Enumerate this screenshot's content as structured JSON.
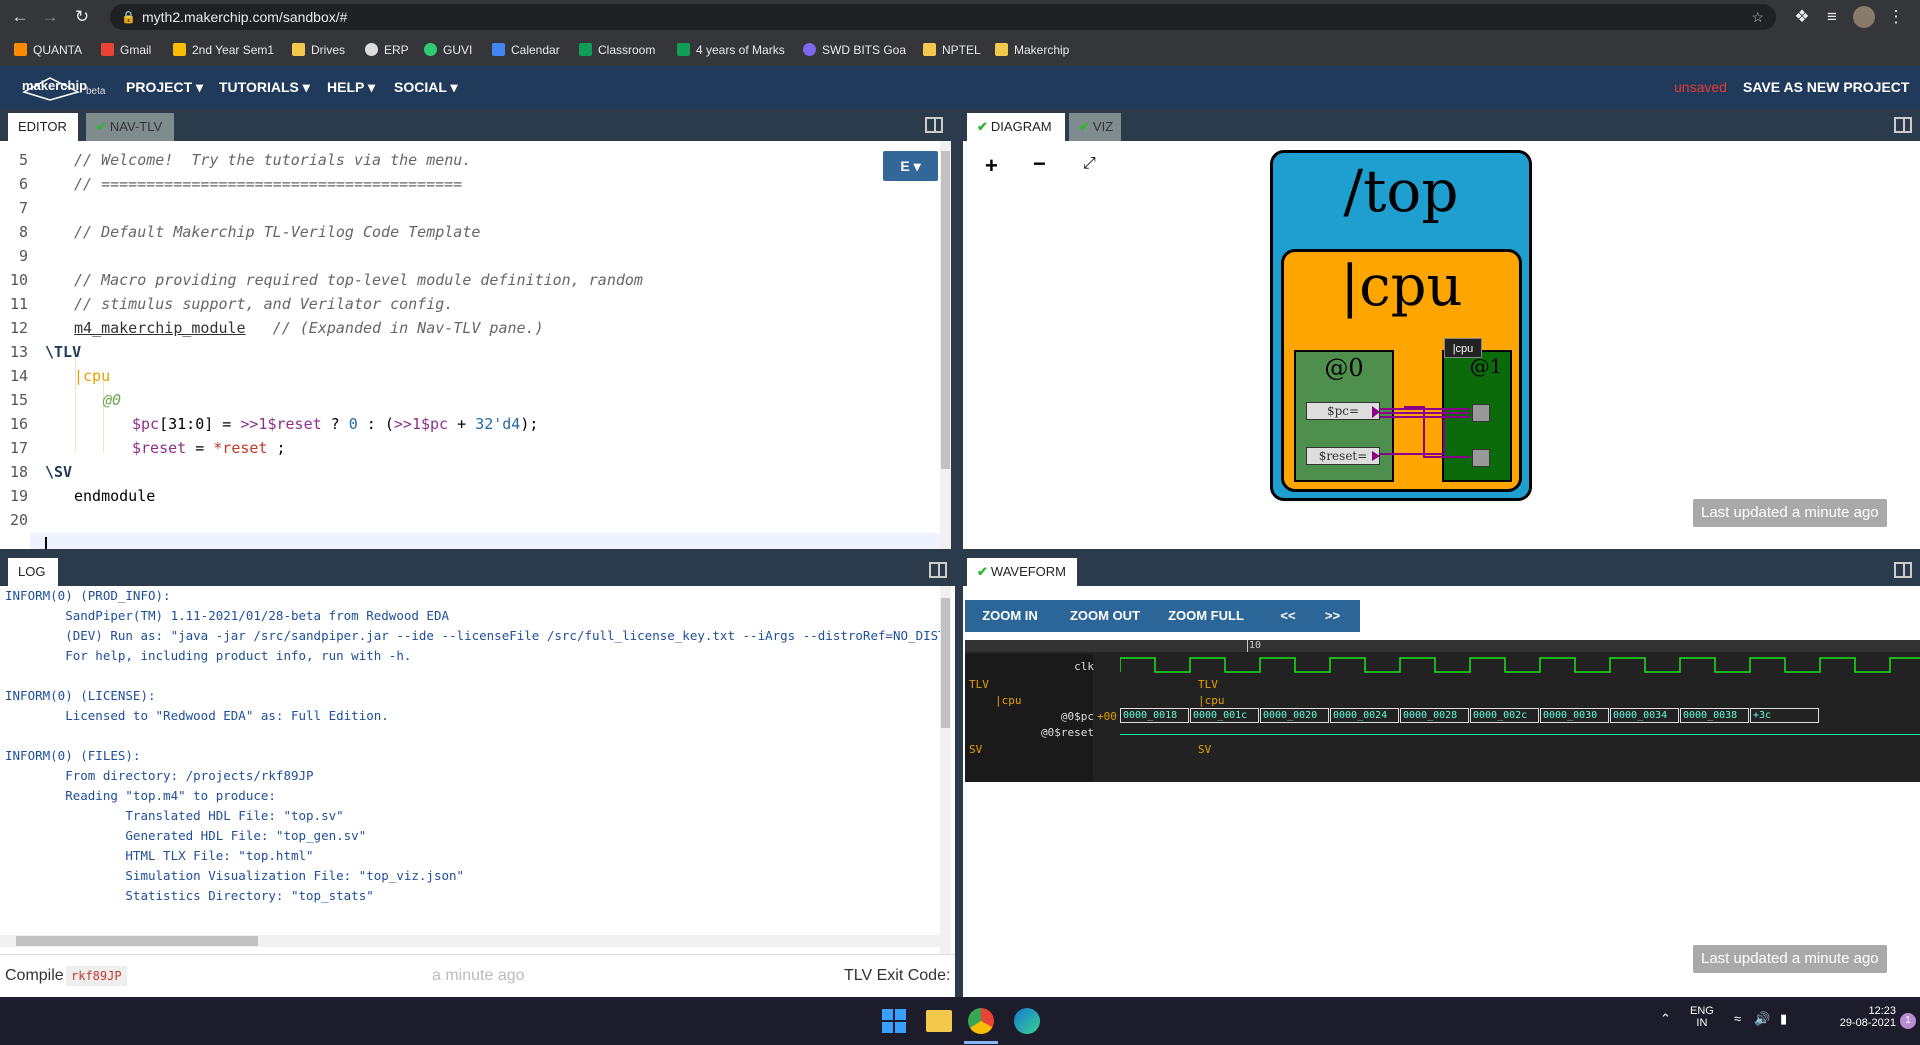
{
  "browser": {
    "url": "myth2.makerchip.com/sandbox/#",
    "bookmarks": [
      "QUANTA",
      "Gmail",
      "2nd Year Sem1",
      "Drives",
      "ERP",
      "GUVI",
      "Calendar",
      "Classroom",
      "4 years of Marks",
      "SWD BITS Goa",
      "NPTEL",
      "Makerchip"
    ]
  },
  "app": {
    "logo": "makerchip",
    "logo_sub": "beta",
    "menu": [
      "PROJECT",
      "TUTORIALS",
      "HELP",
      "SOCIAL"
    ],
    "unsaved": "unsaved",
    "save_button": "SAVE AS NEW PROJECT"
  },
  "editor": {
    "tabs": [
      "EDITOR",
      "NAV-TLV"
    ],
    "mode_button": "E",
    "line_numbers": [
      "5",
      "6",
      "7",
      "8",
      "9",
      "10",
      "11",
      "12",
      "13",
      "14",
      "15",
      "16",
      "17",
      "18",
      "19",
      "20"
    ],
    "lines": {
      "l5": "// Welcome!  Try the tutorials via the menu.",
      "l6": "// ========================================",
      "l8": "// Default Makerchip TL-Verilog Code Template",
      "l10": "// Macro providing required top-level module definition, random",
      "l11": "// stimulus support, and Verilator config.",
      "l12a": "m4_makerchip_module",
      "l12b": "   // (Expanded in Nav-TLV pane.)",
      "l13": "\\TLV",
      "l14": "|cpu",
      "l15": "@0",
      "l16a": "$pc",
      "l16b": "[31:0] = ",
      "l16c": ">>1$reset",
      "l16d": " ? ",
      "l16e": "0",
      "l16f": " : (",
      "l16g": ">>1$pc",
      "l16h": " + ",
      "l16i": "32'd4",
      "l16j": ");",
      "l17a": "$reset",
      "l17b": " = ",
      "l17c": "*reset",
      "l17d": " ;",
      "l18": "\\SV",
      "l19": "endmodule"
    }
  },
  "diagram": {
    "tabs": [
      "DIAGRAM",
      "VIZ"
    ],
    "top_label": "/top",
    "cpu_label": "|cpu",
    "stage_label": "@0",
    "stage2_label": "@1",
    "tooltip": "|cpu",
    "pc_label": "$pc=",
    "reset_label": "$reset=",
    "updated": "Last updated a minute ago"
  },
  "log": {
    "tab": "LOG",
    "lines": [
      "INFORM(0) (PROD_INFO):",
      "        SandPiper(TM) 1.11-2021/01/28-beta from Redwood EDA",
      "        (DEV) Run as: \"java -jar /src/sandpiper.jar --ide --licenseFile /src/full_license_key.txt --iArgs --distroRef=NO_DIST",
      "        For help, including product info, run with -h.",
      "",
      "INFORM(0) (LICENSE):",
      "        Licensed to \"Redwood EDA\" as: Full Edition.",
      "",
      "INFORM(0) (FILES):",
      "        From directory: /projects/rkf89JP",
      "        Reading \"top.m4\" to produce:",
      "                Translated HDL File: \"top.sv\"",
      "                Generated HDL File: \"top_gen.sv\"",
      "                HTML TLX File: \"top.html\"",
      "                Simulation Visualization File: \"top_viz.json\"",
      "                Statistics Directory: \"top_stats\""
    ],
    "compile_label": "Compile",
    "compile_id": "rkf89JP",
    "compile_time": "a minute ago",
    "exit_label": "TLV Exit Code:"
  },
  "waveform": {
    "tab": "WAVEFORM",
    "buttons": [
      "ZOOM IN",
      "ZOOM OUT",
      "ZOOM FULL",
      "<<",
      ">>"
    ],
    "cycle_marker": "10",
    "signals": {
      "clk": "clk",
      "tlv": "TLV",
      "cpu": "|cpu",
      "pc": "@0$pc",
      "pc_val": "+00",
      "reset": "@0$reset",
      "sv": "SV"
    },
    "row_labels": {
      "tlv": "TLV",
      "cpu": "|cpu",
      "sv": "SV"
    },
    "pc_values": [
      "0000_0018",
      "0000_001c",
      "0000_0020",
      "0000_0024",
      "0000_0028",
      "0000_002c",
      "0000_0030",
      "0000_0034",
      "0000_0038",
      "+3c"
    ],
    "updated": "Last updated a minute ago"
  },
  "taskbar": {
    "lang": "ENG",
    "region": "IN",
    "time": "12:23",
    "date": "29-08-2021",
    "notif": "1"
  },
  "colors": {
    "header": "#1f3a5a",
    "top_box": "#1e9fd0",
    "cpu_box": "#ffa500",
    "stage_box": "#4e8f4e",
    "wave_green": "#19e619"
  }
}
